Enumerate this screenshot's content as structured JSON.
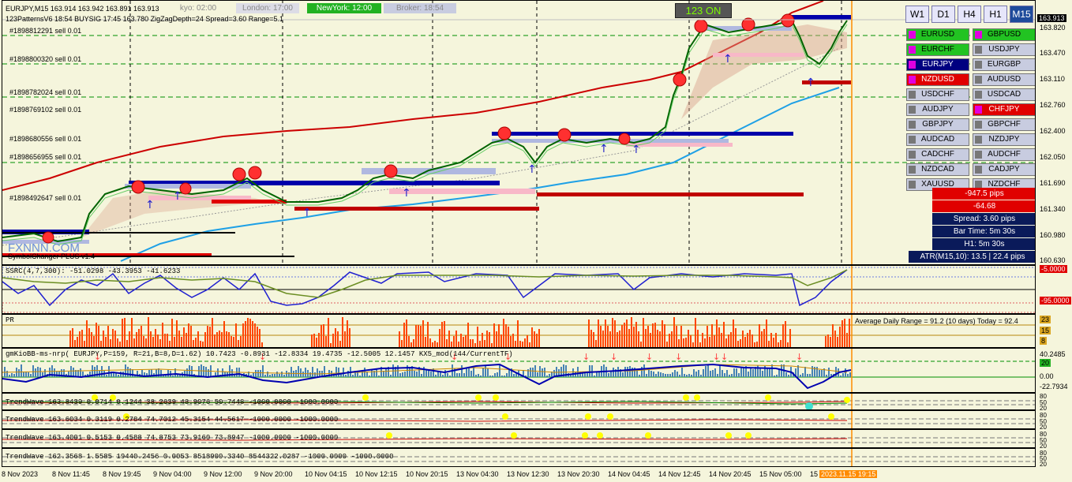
{
  "header": {
    "symbol_line": "EURJPY,M15  163.914 163.942 163.891 163.913",
    "indicator_line": "123PatternsV6  18:54  BUYSIG  17:45  163.780  ZigZagDepth=24  Spread=3.60  Range=5.1",
    "signal_badge": "123 ON"
  },
  "sessions": [
    {
      "label": "kyo: 02:00"
    },
    {
      "label": "London: 17:00"
    },
    {
      "label": "NewYork: 12:00"
    },
    {
      "label": "Broker: 18:54"
    }
  ],
  "timeframes": [
    "W1",
    "D1",
    "H4",
    "H1",
    "M15"
  ],
  "active_timeframe": "M15",
  "symbols": [
    [
      "EURUSD",
      "GBPUSD"
    ],
    [
      "EURCHF",
      "USDJPY"
    ],
    [
      "EURJPY",
      "EURGBP"
    ],
    [
      "NZDUSD",
      "AUDUSD"
    ],
    [
      "USDCHF",
      "USDCAD"
    ],
    [
      "AUDJPY",
      "CHFJPY"
    ],
    [
      "GBPJPY",
      "GBPCHF"
    ],
    [
      "AUDCAD",
      "NZDJPY"
    ],
    [
      "CADCHF",
      "AUDCHF"
    ],
    [
      "NZDCAD",
      "CADJPY"
    ],
    [
      "XAUUSD",
      "NZDCHF"
    ]
  ],
  "info": {
    "pips": "-947.5 pips",
    "value": "-64.68",
    "spread": "Spread: 3.60 pips",
    "bar_time": "Bar Time: 5m 30s",
    "h1": "H1:  5m 30s",
    "atr": "ATR(M15,10): 13.5  |  22.4 pips"
  },
  "sell_orders": [
    "#1898812291 sell 0.01",
    "#1898800320 sell 0.01",
    "#1898782024 sell 0.01",
    "#1898769102 sell 0.01",
    "#1898680556 sell 0.01",
    "#1898656955 sell 0.01",
    "#1898492647 sell 0.01"
  ],
  "watermark": "FXNNN.COM",
  "indicator_name": "SymbolChanger PLUS v1.4",
  "price_axis": [
    "163.913",
    "163.820",
    "163.470",
    "163.110",
    "162.760",
    "162.400",
    "162.050",
    "161.690",
    "161.340",
    "160.980",
    "160.630"
  ],
  "current_price": "163.913",
  "panes": {
    "stoch": {
      "label": "SSRC(4,7,300): -51.0298 -43.3953 -41.6233",
      "levels": [
        "-5.0000",
        "-95.0000"
      ]
    },
    "pr": {
      "label": "PR",
      "text": "Average Daily Range = 91.2 (10 days)    Today = 92.4",
      "axis": [
        "23",
        "15",
        "8"
      ]
    },
    "gmkio": {
      "label": "gmKioBB-ms-nrp( EURJPY,P=159, R=21,B=8,D=1.62) 10.7423 -0.8931 -12.8334 19.4735 -12.5005 12.1457  KX5_mod(144/CurrentTF)",
      "axis": [
        "40.2485",
        "20",
        "0.00",
        "-22.7934"
      ]
    },
    "trend1": {
      "label": "TrendWave 163.8439 0.0714 0.1244 38.2639 48.9076 50.7448 -1000.0000 -1000.0000"
    },
    "trend2": {
      "label": "TrendWave 163.6034 0.3119 0.2784 74.7012 45.3154 44.5617 -1000.0000 -1000.0000"
    },
    "trend3": {
      "label": "TrendWave 163.4001 0.5153 0.4588 74.8753 73.9160 73.8947 -1000.0000 -1000.0000"
    },
    "trend4": {
      "label": "TrendWave 162.3568 1.5585 19440.2456 0.0053 8518909.3340 8544322.0287 -1000.0000 -1000.0000"
    }
  },
  "small_axis": [
    "80",
    "50",
    "20"
  ],
  "time_axis": [
    "8 Nov 2023",
    "8 Nov 11:45",
    "8 Nov 19:45",
    "9 Nov 04:00",
    "9 Nov 12:00",
    "9 Nov 20:00",
    "10 Nov 04:15",
    "10 Nov 12:15",
    "10 Nov 20:15",
    "13 Nov 04:30",
    "13 Nov 12:30",
    "13 Nov 20:30",
    "14 Nov 04:45",
    "14 Nov 12:45",
    "14 Nov 20:45",
    "15 Nov 05:00",
    "15"
  ],
  "cursor_time": "2023.11.15 19:15",
  "colors": {
    "background": "#F5F5DC",
    "bull": "#006400",
    "ma_red": "#CC0000",
    "ma_blue": "#1EA0E6",
    "hist": "#FF4500",
    "cursor": "#FF8C00"
  }
}
